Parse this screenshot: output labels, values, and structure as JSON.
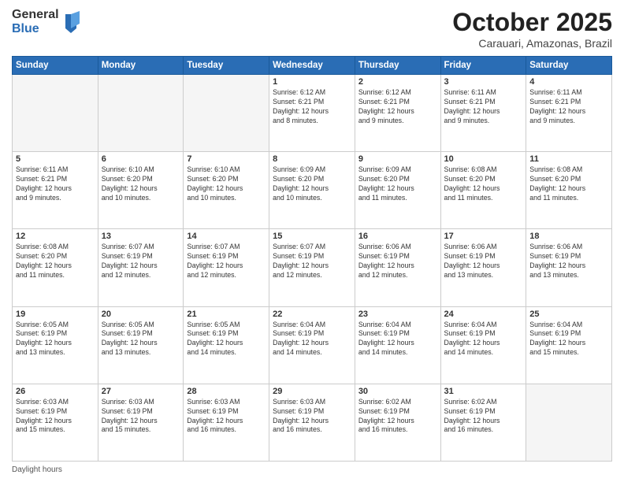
{
  "logo": {
    "general": "General",
    "blue": "Blue"
  },
  "header": {
    "month": "October 2025",
    "location": "Carauari, Amazonas, Brazil"
  },
  "days": [
    "Sunday",
    "Monday",
    "Tuesday",
    "Wednesday",
    "Thursday",
    "Friday",
    "Saturday"
  ],
  "weeks": [
    [
      {
        "day": "",
        "content": ""
      },
      {
        "day": "",
        "content": ""
      },
      {
        "day": "",
        "content": ""
      },
      {
        "day": "1",
        "content": "Sunrise: 6:12 AM\nSunset: 6:21 PM\nDaylight: 12 hours\nand 8 minutes."
      },
      {
        "day": "2",
        "content": "Sunrise: 6:12 AM\nSunset: 6:21 PM\nDaylight: 12 hours\nand 9 minutes."
      },
      {
        "day": "3",
        "content": "Sunrise: 6:11 AM\nSunset: 6:21 PM\nDaylight: 12 hours\nand 9 minutes."
      },
      {
        "day": "4",
        "content": "Sunrise: 6:11 AM\nSunset: 6:21 PM\nDaylight: 12 hours\nand 9 minutes."
      }
    ],
    [
      {
        "day": "5",
        "content": "Sunrise: 6:11 AM\nSunset: 6:21 PM\nDaylight: 12 hours\nand 9 minutes."
      },
      {
        "day": "6",
        "content": "Sunrise: 6:10 AM\nSunset: 6:20 PM\nDaylight: 12 hours\nand 10 minutes."
      },
      {
        "day": "7",
        "content": "Sunrise: 6:10 AM\nSunset: 6:20 PM\nDaylight: 12 hours\nand 10 minutes."
      },
      {
        "day": "8",
        "content": "Sunrise: 6:09 AM\nSunset: 6:20 PM\nDaylight: 12 hours\nand 10 minutes."
      },
      {
        "day": "9",
        "content": "Sunrise: 6:09 AM\nSunset: 6:20 PM\nDaylight: 12 hours\nand 11 minutes."
      },
      {
        "day": "10",
        "content": "Sunrise: 6:08 AM\nSunset: 6:20 PM\nDaylight: 12 hours\nand 11 minutes."
      },
      {
        "day": "11",
        "content": "Sunrise: 6:08 AM\nSunset: 6:20 PM\nDaylight: 12 hours\nand 11 minutes."
      }
    ],
    [
      {
        "day": "12",
        "content": "Sunrise: 6:08 AM\nSunset: 6:20 PM\nDaylight: 12 hours\nand 11 minutes."
      },
      {
        "day": "13",
        "content": "Sunrise: 6:07 AM\nSunset: 6:19 PM\nDaylight: 12 hours\nand 12 minutes."
      },
      {
        "day": "14",
        "content": "Sunrise: 6:07 AM\nSunset: 6:19 PM\nDaylight: 12 hours\nand 12 minutes."
      },
      {
        "day": "15",
        "content": "Sunrise: 6:07 AM\nSunset: 6:19 PM\nDaylight: 12 hours\nand 12 minutes."
      },
      {
        "day": "16",
        "content": "Sunrise: 6:06 AM\nSunset: 6:19 PM\nDaylight: 12 hours\nand 12 minutes."
      },
      {
        "day": "17",
        "content": "Sunrise: 6:06 AM\nSunset: 6:19 PM\nDaylight: 12 hours\nand 13 minutes."
      },
      {
        "day": "18",
        "content": "Sunrise: 6:06 AM\nSunset: 6:19 PM\nDaylight: 12 hours\nand 13 minutes."
      }
    ],
    [
      {
        "day": "19",
        "content": "Sunrise: 6:05 AM\nSunset: 6:19 PM\nDaylight: 12 hours\nand 13 minutes."
      },
      {
        "day": "20",
        "content": "Sunrise: 6:05 AM\nSunset: 6:19 PM\nDaylight: 12 hours\nand 13 minutes."
      },
      {
        "day": "21",
        "content": "Sunrise: 6:05 AM\nSunset: 6:19 PM\nDaylight: 12 hours\nand 14 minutes."
      },
      {
        "day": "22",
        "content": "Sunrise: 6:04 AM\nSunset: 6:19 PM\nDaylight: 12 hours\nand 14 minutes."
      },
      {
        "day": "23",
        "content": "Sunrise: 6:04 AM\nSunset: 6:19 PM\nDaylight: 12 hours\nand 14 minutes."
      },
      {
        "day": "24",
        "content": "Sunrise: 6:04 AM\nSunset: 6:19 PM\nDaylight: 12 hours\nand 14 minutes."
      },
      {
        "day": "25",
        "content": "Sunrise: 6:04 AM\nSunset: 6:19 PM\nDaylight: 12 hours\nand 15 minutes."
      }
    ],
    [
      {
        "day": "26",
        "content": "Sunrise: 6:03 AM\nSunset: 6:19 PM\nDaylight: 12 hours\nand 15 minutes."
      },
      {
        "day": "27",
        "content": "Sunrise: 6:03 AM\nSunset: 6:19 PM\nDaylight: 12 hours\nand 15 minutes."
      },
      {
        "day": "28",
        "content": "Sunrise: 6:03 AM\nSunset: 6:19 PM\nDaylight: 12 hours\nand 16 minutes."
      },
      {
        "day": "29",
        "content": "Sunrise: 6:03 AM\nSunset: 6:19 PM\nDaylight: 12 hours\nand 16 minutes."
      },
      {
        "day": "30",
        "content": "Sunrise: 6:02 AM\nSunset: 6:19 PM\nDaylight: 12 hours\nand 16 minutes."
      },
      {
        "day": "31",
        "content": "Sunrise: 6:02 AM\nSunset: 6:19 PM\nDaylight: 12 hours\nand 16 minutes."
      },
      {
        "day": "",
        "content": ""
      }
    ]
  ],
  "footer": {
    "note": "Daylight hours"
  }
}
